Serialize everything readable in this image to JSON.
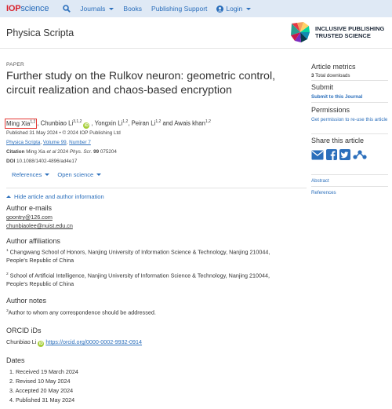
{
  "nav": {
    "logo_iop": "IOP",
    "logo_science": "science",
    "journals": "Journals",
    "books": "Books",
    "publishing_support": "Publishing Support",
    "login": "Login"
  },
  "journal": {
    "title": "Physica Scripta",
    "badge_line1": "INCLUSIVE PUBLISHING",
    "badge_line2": "TRUSTED SCIENCE"
  },
  "article": {
    "type_label": "PAPER",
    "title": "Further study on the Rulkov neuron: geometric control, circuit realization and chaos-based encryption",
    "authors": [
      {
        "name": "Ming Xia",
        "sup": "1,2"
      },
      {
        "name": "Chunbiao Li",
        "sup": "3,1,2"
      },
      {
        "name": "Yongxin Li",
        "sup": "1,2"
      },
      {
        "name": "Peiran Li",
        "sup": "1,2"
      },
      {
        "name": "Awais khan",
        "sup": "1,2"
      }
    ],
    "sep_comma": ", ",
    "sep_and": " and ",
    "published": "Published 31 May 2024 • © 2024 IOP Publishing Ltd",
    "journal_link": "Physica Scripta",
    "volume_link": "Volume 99",
    "number_link": "Number 7",
    "citation_label": "Citation",
    "citation_authors": "Ming Xia",
    "citation_etal": "et al",
    "citation_year": "2024",
    "citation_journal": "Phys. Scr.",
    "citation_volume": "99",
    "citation_number": "075204",
    "doi_label": "DOI",
    "doi": "10.1088/1402-4896/ad4e17",
    "references_label": "References",
    "open_science_label": "Open science"
  },
  "info": {
    "hide_label": "Hide article and author information",
    "emails_heading": "Author e-mails",
    "emails": [
      "goontry@126.com",
      "chunbiaolee@nuist.edu.cn"
    ],
    "affiliations_heading": "Author affiliations",
    "affiliations": [
      {
        "num": "1",
        "text": "Changwang School of Honors, Nanjing University of Information Science & Technology, Nanjing 210044, People's Republic of China"
      },
      {
        "num": "2",
        "text": "School of Artificial Intelligence, Nanjing University of Information Science & Technology, Nanjing 210044, People's Republic of China"
      }
    ],
    "notes_heading": "Author notes",
    "note_num": "3",
    "note_text": "Author to whom any correspondence should be addressed.",
    "orcid_heading": "ORCID iDs",
    "orcid_name": "Chunbiao Li",
    "orcid_url": "https://orcid.org/0000-0002-9932-0914",
    "dates_heading": "Dates",
    "dates": [
      "1. Received 19 March 2024",
      "2. Revised 10 May 2024",
      "3. Accepted 20 May 2024",
      "4. Published 31 May 2024"
    ]
  },
  "sidebar": {
    "metrics_heading": "Article metrics",
    "metrics_count": "3",
    "metrics_label": "Total downloads",
    "submit_heading": "Submit",
    "submit_link": "Submit to this Journal",
    "permissions_heading": "Permissions",
    "permissions_link": "Get permission to re-use this article",
    "share_heading": "Share this article",
    "abstract_link": "Abstract",
    "references_link": "References"
  },
  "colors": {
    "accent": "#2a6ebb",
    "nav_bg": "#dfe9f5",
    "highlight": "#e53935",
    "orcid": "#a6ce39"
  }
}
